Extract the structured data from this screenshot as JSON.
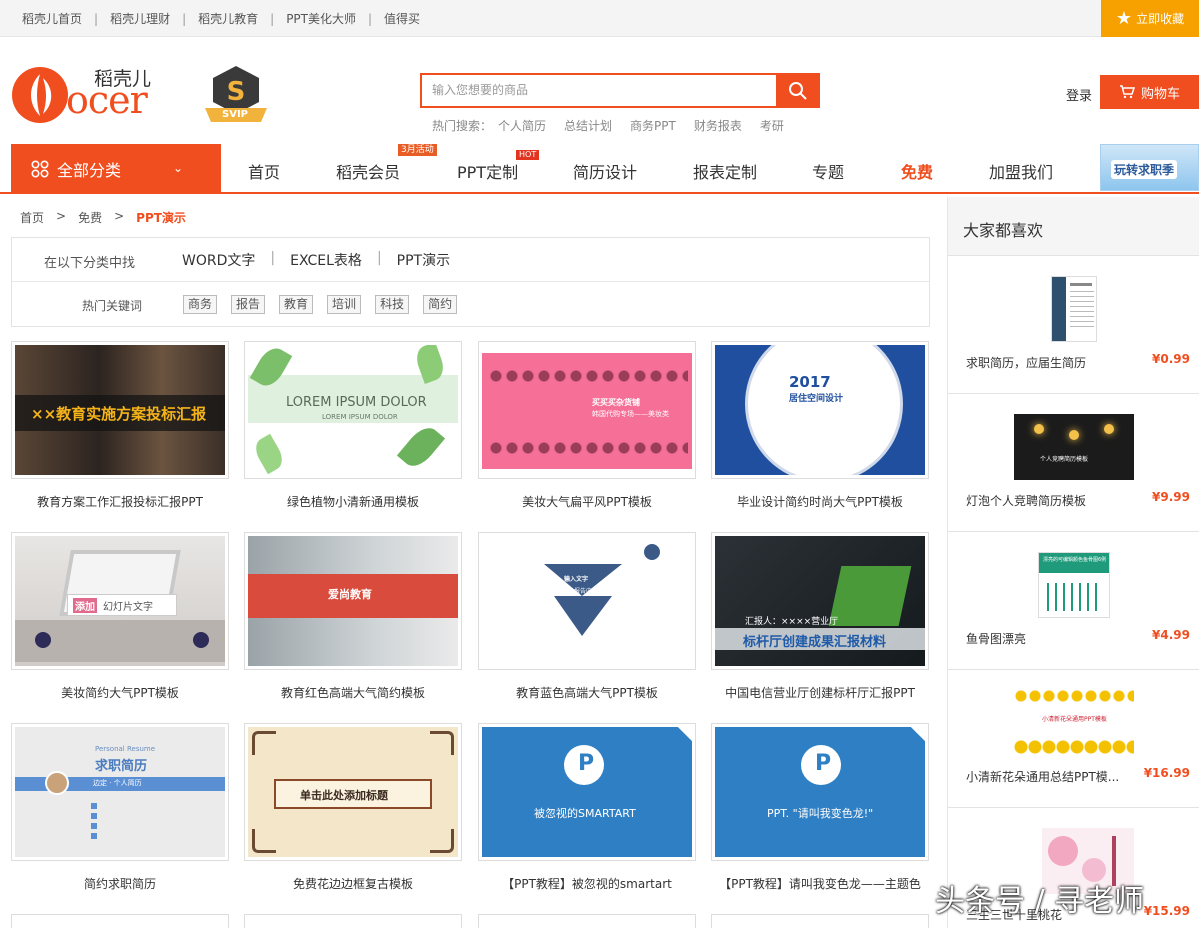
{
  "topbar": {
    "links": [
      "稻壳儿首页",
      "稻壳儿理财",
      "稻壳儿教育",
      "PPT美化大师",
      "值得买"
    ],
    "favorite": "立即收藏"
  },
  "header": {
    "logo_text": "ocer",
    "logo_cn": "稻壳儿",
    "svip": "SVIP",
    "search_placeholder": "输入您想要的商品",
    "hot_label": "热门搜索：",
    "hot_terms": [
      "个人简历",
      "总结计划",
      "商务PPT",
      "财务报表",
      "考研"
    ],
    "login": "登录",
    "cart": "购物车"
  },
  "nav": {
    "all_categories": "全部分类",
    "items": [
      "首页",
      "稻壳会员",
      "PPT定制",
      "简历设计",
      "报表定制",
      "专题",
      "免费",
      "加盟我们"
    ],
    "badge_member": "3月活动",
    "badge_ppt": "HOT",
    "banner": "玩转求职季"
  },
  "breadcrumb": [
    "首页",
    ">",
    "免费",
    ">",
    "PPT演示"
  ],
  "filter": {
    "label": "在以下分类中找",
    "categories": [
      "WORD文字",
      "EXCEL表格",
      "PPT演示"
    ],
    "hot_label": "热门关键词",
    "tags": [
      "商务",
      "报告",
      "教育",
      "培训",
      "科技",
      "简约"
    ]
  },
  "templates": [
    {
      "caption": "教育方案工作汇报投标汇报PPT",
      "thumb_text": "××教育实施方案投标汇报"
    },
    {
      "caption": "绿色植物小清新通用模板",
      "thumb_text": "LOREM IPSUM DOLOR",
      "thumb_sub": "LOREM IPSUM DOLOR"
    },
    {
      "caption": "美妆大气扁平风PPT模板",
      "thumb_text": "买买买杂货铺",
      "thumb_sub": "韩国代购专场——美妆类"
    },
    {
      "caption": "毕业设计简约时尚大气PPT模板",
      "thumb_text": "2017",
      "thumb_sub": "居住空间设计"
    },
    {
      "caption": "美妆简约大气PPT模板",
      "thumb_text": "添加",
      "thumb_sub": "幻灯片文字"
    },
    {
      "caption": "教育红色高端大气简约模板",
      "thumb_text": "爱尚教育"
    },
    {
      "caption": "教育蓝色高端大气PPT模板",
      "thumb_text": "输入文字",
      "thumb_sub": "输入报告内容"
    },
    {
      "caption": "中国电信营业厅创建标杆厅汇报PPT",
      "thumb_text": "标杆厅创建成果汇报材料",
      "thumb_sub": "汇报人：××××营业厅"
    },
    {
      "caption": "简约求职简历",
      "thumb_text": "求职简历",
      "thumb_sub": "Personal Resume",
      "thumb_extra": "边定 · 个人简历"
    },
    {
      "caption": "免费花边边框复古模板",
      "thumb_text": "单击此处添加标题"
    },
    {
      "caption": "【PPT教程】被忽视的smartart",
      "thumb_text": "被忽视的SMARTART"
    },
    {
      "caption": "【PPT教程】请叫我变色龙——主题色",
      "thumb_text": "PPT. \"请叫我变色龙!\""
    }
  ],
  "sidebar": {
    "title": "大家都喜欢",
    "items": [
      {
        "name": "求职简历，应届生简历",
        "price": "¥0.99"
      },
      {
        "name": "灯泡个人竞聘简历模板",
        "price": "¥9.99",
        "thumb_text": "个人竞聘简历模板"
      },
      {
        "name": "鱼骨图漂亮",
        "price": "¥4.99",
        "thumb_text": "漂亮的可编辑颜色鱼骨图6例"
      },
      {
        "name": "小清新花朵通用总结PPT模...",
        "price": "¥16.99",
        "thumb_text": "小清新花朵通用PPT模板"
      },
      {
        "name": "三生三世十里桃花",
        "price": "¥15.99"
      }
    ]
  },
  "watermark": "头条号 / 寻老师",
  "colors": {
    "accent": "#f04e1f",
    "favorite": "#f7a100"
  }
}
